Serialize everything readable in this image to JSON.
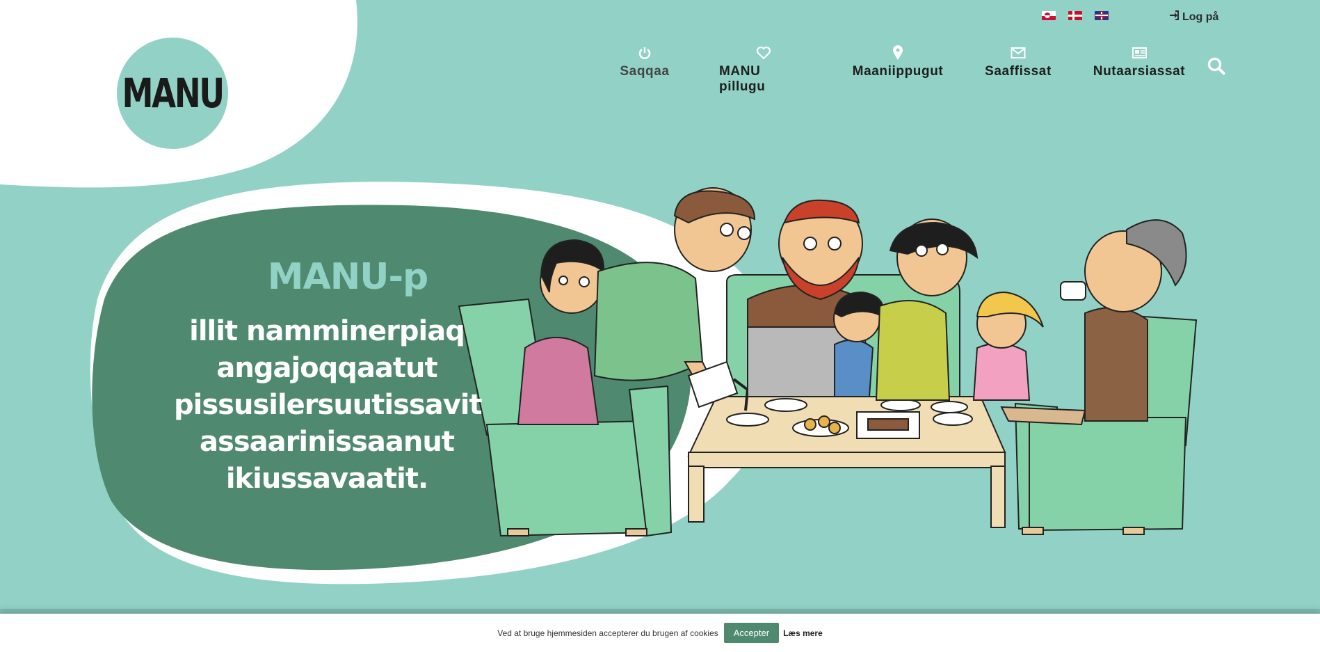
{
  "brand": {
    "logo_text": "MANU"
  },
  "languages": [
    {
      "code": "kl",
      "icon": "greenland-flag-icon"
    },
    {
      "code": "da",
      "icon": "denmark-flag-icon"
    },
    {
      "code": "en",
      "icon": "uk-flag-icon"
    }
  ],
  "login": {
    "label": "Log på",
    "icon": "sign-in-icon"
  },
  "nav": {
    "items": [
      {
        "label": "Saqqaa",
        "icon": "power-icon"
      },
      {
        "label": "MANU pillugu",
        "icon": "heart-icon"
      },
      {
        "label": "Maaniippugut",
        "icon": "map-pin-icon"
      },
      {
        "label": "Saaffissat",
        "icon": "envelope-icon"
      },
      {
        "label": "Nutaarsiassat",
        "icon": "newspaper-icon"
      }
    ],
    "search_icon": "search-icon"
  },
  "hero": {
    "title": "MANU-p",
    "lines": [
      "illit namminerpiaq",
      "angajoqqaatut",
      "pissusilersuutissavit",
      "assaarinissaanut",
      "ikiussavaatit."
    ],
    "illustration": "family-around-table-illustration"
  },
  "cookie": {
    "text": "Ved at bruge hjemmesiden accepterer du brugen af cookies",
    "accept": "Accepter",
    "more": "Læs mere"
  },
  "colors": {
    "mint": "#92d2c6",
    "dark_green": "#4f8a70",
    "chair_green": "#86d2a8",
    "white": "#ffffff"
  }
}
